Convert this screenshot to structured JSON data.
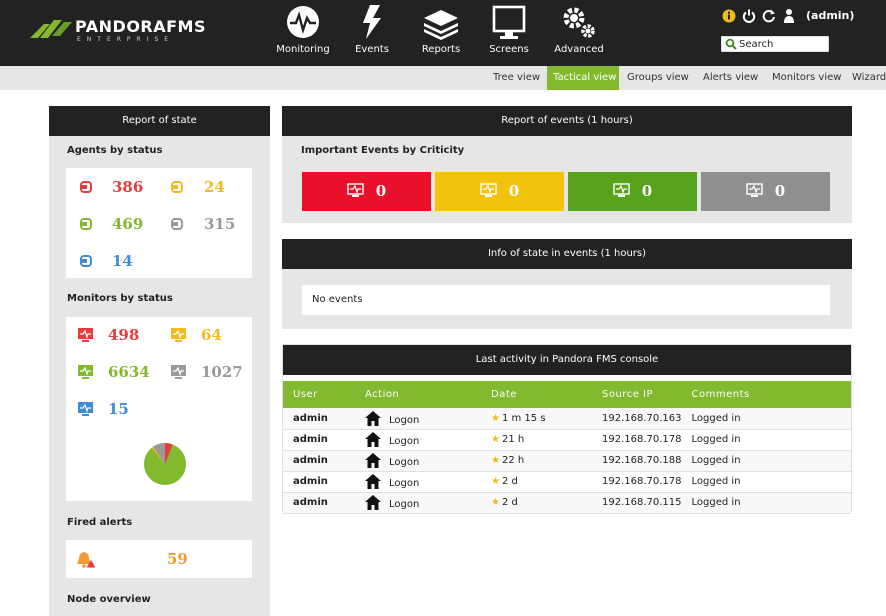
{
  "header": {
    "brand": "PANDORAFMS",
    "brand_sub": "ENTERPRISE",
    "nav": [
      {
        "label": "Monitoring",
        "icon": "monitoring-icon"
      },
      {
        "label": "Events",
        "icon": "lightning-icon"
      },
      {
        "label": "Reports",
        "icon": "reports-icon"
      },
      {
        "label": "Screens",
        "icon": "screen-icon"
      },
      {
        "label": "Advanced",
        "icon": "gears-icon"
      }
    ],
    "user": "(admin)",
    "search_placeholder": "Search"
  },
  "subnav": {
    "tabs": [
      {
        "label": "Tree view",
        "active": false
      },
      {
        "label": "Tactical view",
        "active": true
      },
      {
        "label": "Groups view",
        "active": false
      },
      {
        "label": "Alerts view",
        "active": false
      },
      {
        "label": "Monitors view",
        "active": false
      },
      {
        "label": "Wizard",
        "active": false
      }
    ]
  },
  "report_state": {
    "title": "Report of state",
    "agents_title": "Agents by status",
    "agents": {
      "critical": "386",
      "warning": "24",
      "normal": "469",
      "unknown": "315",
      "notinit": "14"
    },
    "monitors_title": "Monitors by status",
    "monitors": {
      "critical": "498",
      "warning": "64",
      "normal": "6634",
      "unknown": "1027",
      "notinit": "15"
    },
    "alerts_title": "Fired alerts",
    "alerts_count": "59",
    "node_title": "Node overview"
  },
  "events_report": {
    "title": "Report of events (1 hours)",
    "subtitle": "Important Events by Criticity",
    "boxes": [
      {
        "value": "0",
        "color": "#e8102a"
      },
      {
        "value": "0",
        "color": "#f2c20d"
      },
      {
        "value": "0",
        "color": "#58a21c"
      },
      {
        "value": "0",
        "color": "#8f8f8f"
      }
    ]
  },
  "info_state": {
    "title": "Info of state in events (1 hours)",
    "empty": "No events"
  },
  "last_activity": {
    "title": "Last activity in Pandora FMS console",
    "columns": [
      "User",
      "Action",
      "Date",
      "Source IP",
      "Comments"
    ],
    "rows": [
      {
        "user": "admin",
        "action": "Logon",
        "date": "1 m 15 s",
        "ip": "192.168.70.163",
        "comment": "Logged in"
      },
      {
        "user": "admin",
        "action": "Logon",
        "date": "21 h",
        "ip": "192.168.70.178",
        "comment": "Logged in"
      },
      {
        "user": "admin",
        "action": "Logon",
        "date": "22 h",
        "ip": "192.168.70.188",
        "comment": "Logged in"
      },
      {
        "user": "admin",
        "action": "Logon",
        "date": "2 d",
        "ip": "192.168.70.178",
        "comment": "Logged in"
      },
      {
        "user": "admin",
        "action": "Logon",
        "date": "2 d",
        "ip": "192.168.70.115",
        "comment": "Logged in"
      }
    ]
  },
  "colors": {
    "brand_green": "#82b92e",
    "critical": "#e63c3c",
    "warning": "#f2ba1e",
    "unknown": "#999999",
    "notinit": "#3f8cd9",
    "header": "#222222"
  }
}
